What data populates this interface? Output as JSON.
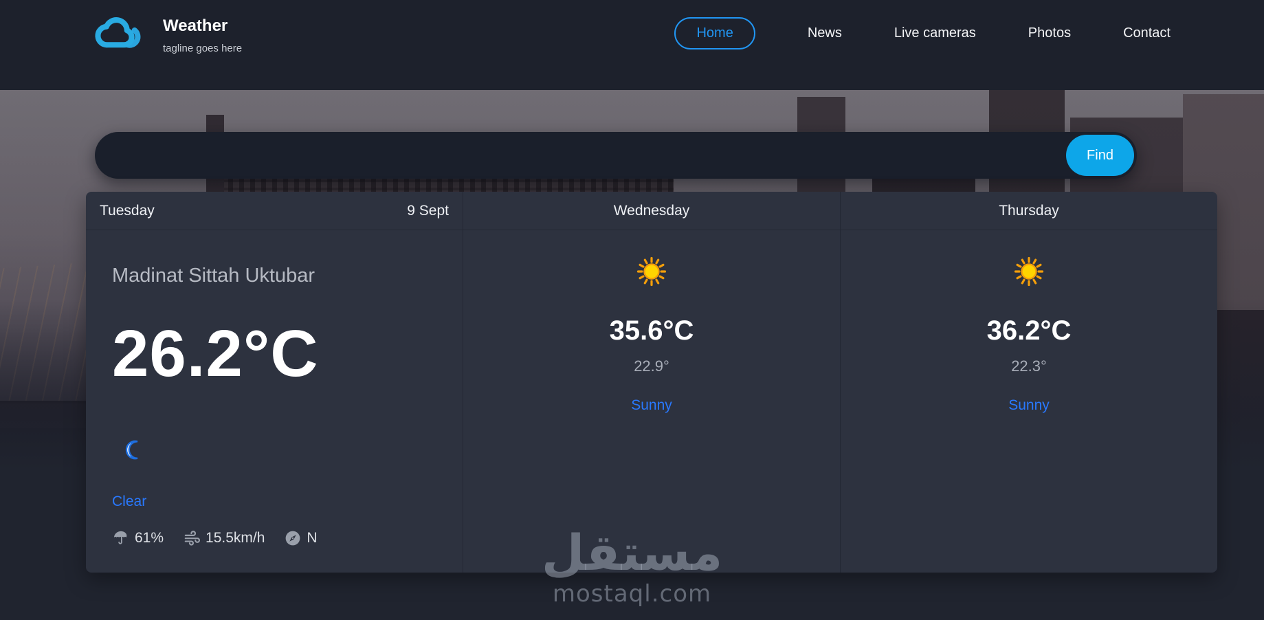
{
  "brand": {
    "title": "Weather",
    "tagline": "tagline goes here"
  },
  "nav": {
    "items": [
      {
        "label": "Home",
        "active": true
      },
      {
        "label": "News",
        "active": false
      },
      {
        "label": "Live cameras",
        "active": false
      },
      {
        "label": "Photos",
        "active": false
      },
      {
        "label": "Contact",
        "active": false
      }
    ]
  },
  "search": {
    "placeholder": "",
    "button_label": "Find"
  },
  "forecast": {
    "cards": [
      {
        "day": "Tuesday",
        "date": "9 Sept",
        "location": "Madinat Sittah Uktubar",
        "temp": "26.2°C",
        "condition": "Clear",
        "condition_icon": "crescent-moon",
        "humidity": "61%",
        "wind_speed": "15.5km/h",
        "wind_direction": "N"
      },
      {
        "day": "Wednesday",
        "temp": "35.6°C",
        "temp_low": "22.9°",
        "condition": "Sunny",
        "condition_icon": "sun"
      },
      {
        "day": "Thursday",
        "temp": "36.2°C",
        "temp_low": "22.3°",
        "condition": "Sunny",
        "condition_icon": "sun"
      }
    ]
  },
  "watermark": {
    "arabic": "مستقل",
    "latin": "mostaql.com"
  },
  "colors": {
    "navbar_bg": "#1d212c",
    "page_bg": "#20242f",
    "card_bg": "#2d323f",
    "search_bg": "#1a1f2b",
    "accent_nav_blue": "#2196f3",
    "link_blue": "#2979ff",
    "find_button_cyan": "#0da6e9",
    "sun_yellow": "#ffd400",
    "sun_ray_orange": "#f59f0a"
  }
}
